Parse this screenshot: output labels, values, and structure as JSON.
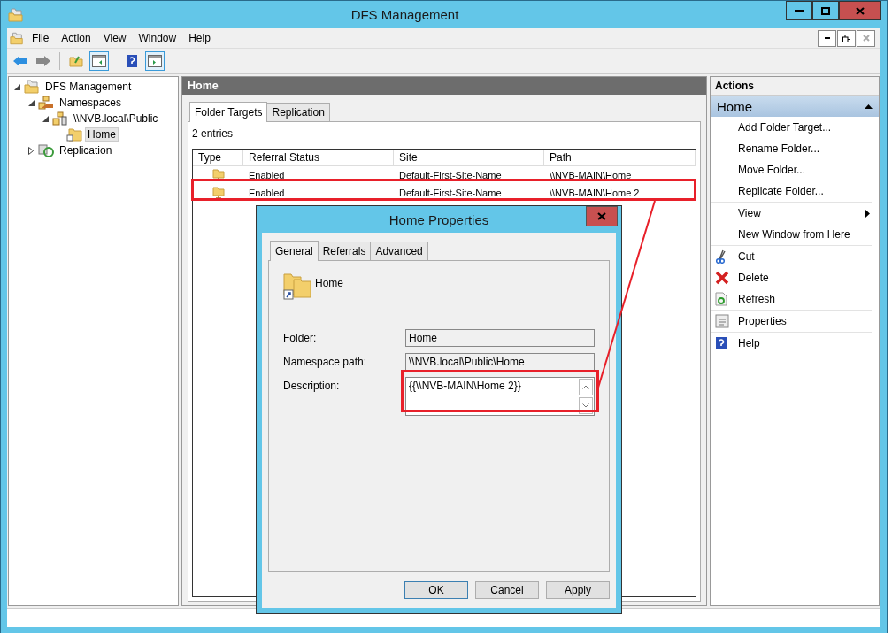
{
  "window": {
    "title": "DFS Management"
  },
  "menu": [
    "File",
    "Action",
    "View",
    "Window",
    "Help"
  ],
  "tree": [
    {
      "label": "DFS Management",
      "kind": "root",
      "selected": false,
      "expanded": true,
      "children": [
        {
          "label": "Namespaces",
          "kind": "namespaces",
          "selected": false,
          "expanded": true,
          "children": [
            {
              "label": "\\\\NVB.local\\Public",
              "kind": "namespace",
              "selected": false,
              "expanded": true,
              "children": [
                {
                  "label": "Home",
                  "kind": "folder",
                  "selected": true
                }
              ]
            }
          ]
        },
        {
          "label": "Replication",
          "kind": "replication",
          "selected": false,
          "expanded": false
        }
      ]
    }
  ],
  "content": {
    "header": "Home",
    "tabs": [
      {
        "label": "Folder Targets",
        "selected": true
      },
      {
        "label": "Replication",
        "selected": false
      }
    ],
    "count": "2 entries",
    "columns": [
      "Type",
      "Referral Status",
      "Site",
      "Path"
    ],
    "rows": [
      {
        "status": "Enabled",
        "site": "Default-First-Site-Name",
        "path": "\\\\NVB-MAIN\\Home",
        "highlighted": false
      },
      {
        "status": "Enabled",
        "site": "Default-First-Site-Name",
        "path": "\\\\NVB-MAIN\\Home 2",
        "highlighted": true
      }
    ]
  },
  "actions": {
    "title": "Actions",
    "group": "Home",
    "items": [
      {
        "label": "Add Folder Target...",
        "kind": "plain",
        "separator_after": false
      },
      {
        "label": "Rename Folder...",
        "kind": "plain",
        "separator_after": false
      },
      {
        "label": "Move Folder...",
        "kind": "plain",
        "separator_after": false
      },
      {
        "label": "Replicate Folder...",
        "kind": "plain",
        "separator_after": true
      },
      {
        "label": "View",
        "kind": "submenu",
        "separator_after": false
      },
      {
        "label": "New Window from Here",
        "kind": "plain",
        "separator_after": true
      },
      {
        "label": "Cut",
        "kind": "cut",
        "separator_after": false
      },
      {
        "label": "Delete",
        "kind": "delete",
        "separator_after": false
      },
      {
        "label": "Refresh",
        "kind": "refresh",
        "separator_after": true
      },
      {
        "label": "Properties",
        "kind": "properties",
        "separator_after": true
      },
      {
        "label": "Help",
        "kind": "help",
        "separator_after": false
      }
    ]
  },
  "dialog": {
    "title": "Home Properties",
    "tabs": [
      {
        "label": "General",
        "selected": true
      },
      {
        "label": "Referrals",
        "selected": false
      },
      {
        "label": "Advanced",
        "selected": false
      }
    ],
    "name": "Home",
    "fields": [
      {
        "label": "Folder:",
        "value": "Home",
        "kind": "text",
        "highlighted": false
      },
      {
        "label": "Namespace path:",
        "value": "\\\\NVB.local\\Public\\Home",
        "kind": "text",
        "highlighted": false
      },
      {
        "label": "Description:",
        "value": "{{\\\\NVB-MAIN\\Home 2}}",
        "kind": "multiline",
        "highlighted": true
      }
    ],
    "buttons": [
      {
        "label": "OK",
        "default": true
      },
      {
        "label": "Cancel",
        "default": false
      },
      {
        "label": "Apply",
        "default": false
      }
    ]
  }
}
